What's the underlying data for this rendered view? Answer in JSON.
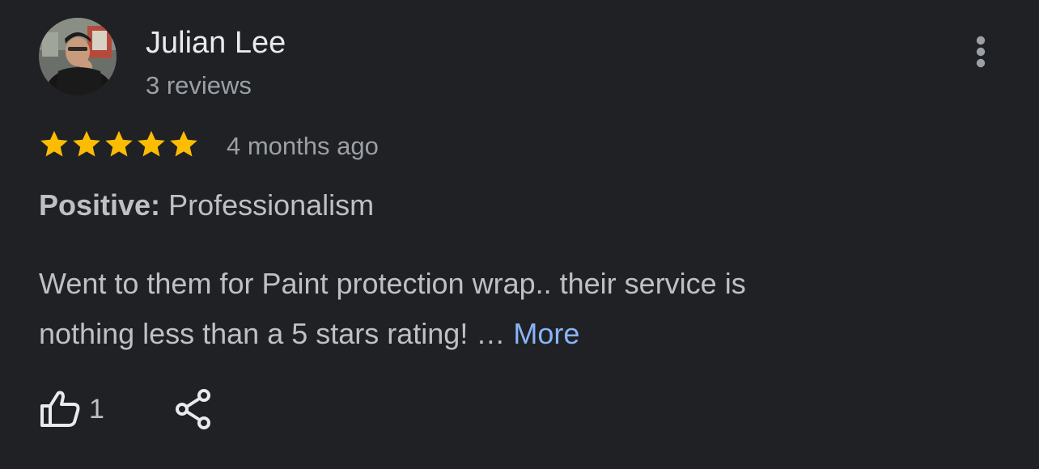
{
  "review": {
    "author": {
      "name": "Julian Lee",
      "review_count": "3 reviews",
      "avatar_icon": "user-avatar-photo"
    },
    "rating": {
      "stars": 5,
      "max_stars": 5,
      "star_color": "#fbbc04"
    },
    "time_ago": "4 months ago",
    "highlight": {
      "key": "Positive:",
      "value": "Professionalism"
    },
    "text_line1": "Went to them for Paint protection wrap.. their service is",
    "text_line2": "nothing less than a 5 stars rating! … ",
    "more_label": "More",
    "like_count": "1",
    "icons": {
      "menu": "more-vertical-icon",
      "like": "thumbs-up-icon",
      "share": "share-icon"
    },
    "colors": {
      "background": "#202124",
      "link": "#8ab4f8",
      "secondary_text": "#9aa0a6"
    }
  }
}
